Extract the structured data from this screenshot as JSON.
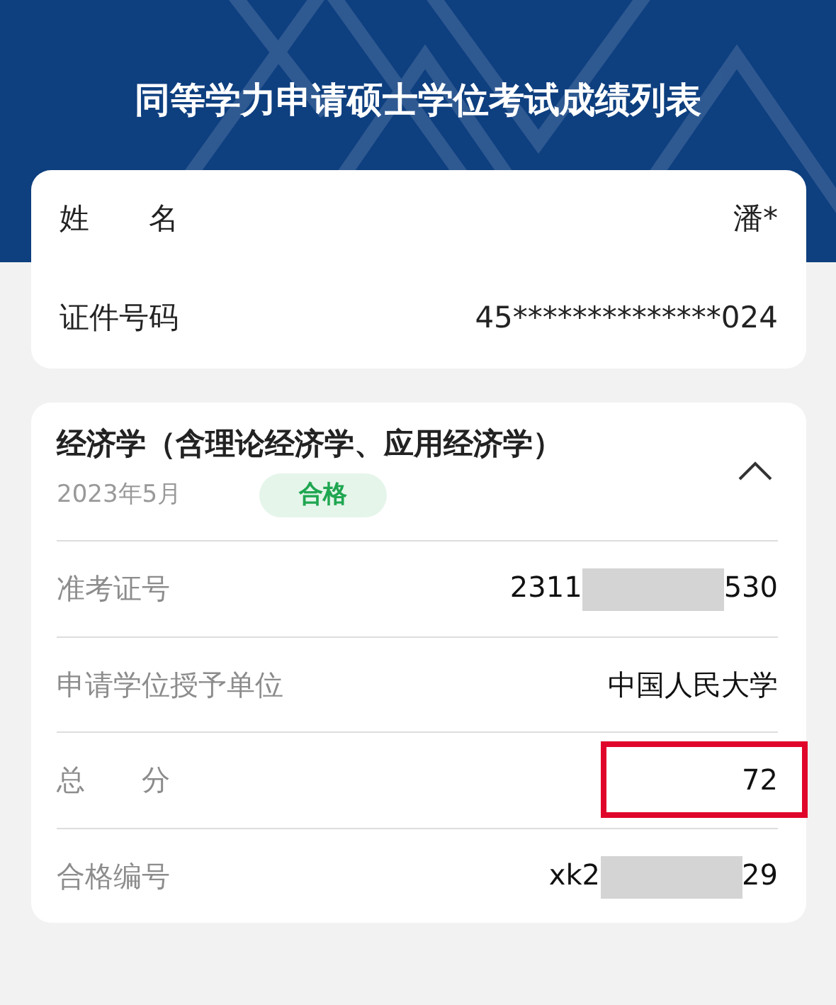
{
  "page_title": "同等学力申请硕士学位考试成绩列表",
  "person": [
    {
      "label": "姓　　名",
      "value": "潘*"
    },
    {
      "label": "证件号码",
      "value": "45**************024"
    }
  ],
  "subjects": [
    {
      "name": "经济学（含理论经济学、应用经济学）",
      "date": "2023年5月",
      "result": "合格",
      "expanded": true,
      "fields": [
        {
          "label": "准考证号",
          "value_parts": [
            "2311",
            "530"
          ],
          "redacted": true,
          "highlighted": false
        },
        {
          "label": "申请学位授予单位",
          "value_parts": [
            "中国人民大学"
          ],
          "redacted": false,
          "highlighted": false
        },
        {
          "label": "总　　分",
          "value_parts": [
            "72"
          ],
          "redacted": false,
          "highlighted": true
        },
        {
          "label": "合格编号",
          "value_parts": [
            "xk2",
            "29"
          ],
          "redacted": true,
          "highlighted": false
        }
      ]
    }
  ]
}
